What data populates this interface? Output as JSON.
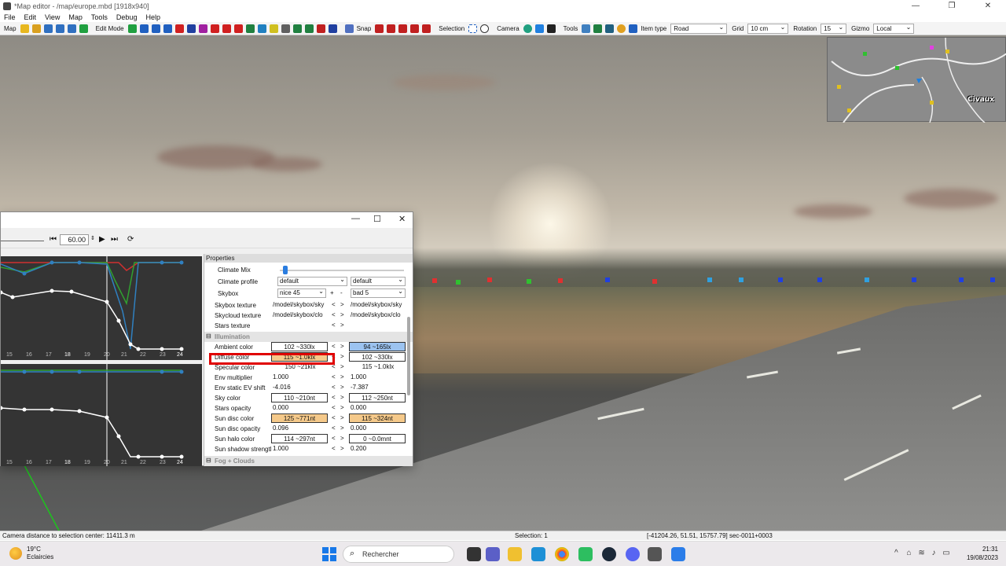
{
  "window": {
    "title": "*Map editor - /map/europe.mbd [1918x940]",
    "minimize": "—",
    "maximize": "❐",
    "close": "✕"
  },
  "menu": [
    "File",
    "Edit",
    "View",
    "Map",
    "Tools",
    "Debug",
    "Help"
  ],
  "toolbar": {
    "map_label": "Map",
    "edit_mode_label": "Edit Mode",
    "snap_label": "Snap",
    "selection_label": "Selection",
    "camera_label": "Camera",
    "tools_label": "Tools",
    "item_type_label": "Item type",
    "item_type_value": "Road",
    "grid_label": "Grid",
    "grid_value": "10 cm",
    "rotation_label": "Rotation",
    "rotation_value": "15",
    "gizmo_label": "Gizmo",
    "gizmo_value": "Local"
  },
  "minimap": {
    "label": "Civaux"
  },
  "panel": {
    "minimize": "—",
    "maximize": "☐",
    "close": "✕",
    "time_value": "60.00",
    "graph_ticks_top": [
      "15",
      "16",
      "17",
      "18",
      "19",
      "20",
      "21",
      "22",
      "23",
      "24"
    ],
    "graph_ticks_bottom": [
      "15",
      "16",
      "17",
      "18",
      "19",
      "20",
      "21",
      "22",
      "23",
      "24"
    ],
    "properties_header": "Properties",
    "climate_mix_label": "Climate Mix",
    "climate_profile_label": "Climate profile",
    "climate_profile_a": "default",
    "climate_profile_b": "default",
    "skybox_label": "Skybox",
    "skybox_a": "nice 45",
    "skybox_b": "bad 5",
    "skybox_plus": "+",
    "skybox_minus": "-",
    "rows": [
      {
        "label": "Skybox texture",
        "a": "/model/skybox/sky",
        "b": "/model/skybox/sky",
        "boxed": false
      },
      {
        "label": "Skycloud texture",
        "a": "/model/skybox/clo",
        "b": "/model/skybox/clo",
        "boxed": false
      },
      {
        "label": "Stars texture",
        "a": "",
        "b": "",
        "boxed": false
      }
    ],
    "illumination_label": "Illumination",
    "illum_rows": [
      {
        "label": "Ambient color",
        "a": "102 ~330lx",
        "b": "94 ~165lx"
      },
      {
        "label": "Diffuse color",
        "a": "115 ~1.0klx",
        "b": "102 ~330lx"
      },
      {
        "label": "Specular color",
        "a": "150 ~21klx",
        "b": "115 ~1.0klx"
      },
      {
        "label": "Env multiplier",
        "a": "1.000",
        "b": "1.000"
      },
      {
        "label": "Env static EV shift",
        "a": "-4.016",
        "b": "-7.387"
      },
      {
        "label": "Sky color",
        "a": "110 ~210nt",
        "b": "112 ~250nt"
      },
      {
        "label": "Stars opacity",
        "a": "0.000",
        "b": "0.000"
      },
      {
        "label": "Sun disc color",
        "a": "125 ~771nt",
        "b": "115 ~324nt"
      },
      {
        "label": "Sun disc opacity",
        "a": "0.096",
        "b": "0.000"
      },
      {
        "label": "Sun halo color",
        "a": "114 ~297nt",
        "b": "0 ~0.0mnt"
      },
      {
        "label": "Sun shadow strength",
        "a": "1.000",
        "b": "0.200"
      }
    ],
    "fog_label": "Fog + Clouds",
    "arrow_left": "<",
    "arrow_right": ">"
  },
  "status": {
    "camera_distance": "Camera distance to selection center: 11411.3 m",
    "selection": "Selection: 1",
    "coords": "[-41204.26, 51.51, 15757.79] sec-0011+0003"
  },
  "taskbar": {
    "temperature": "19°C",
    "weather": "Eclaircies",
    "search_placeholder": "Rechercher",
    "time": "21:31",
    "date": "19/08/2023",
    "tray_chevron": "^"
  },
  "colors": {
    "ambient_b_bg": "#9cc3f0",
    "diffuse_a_bg": "#f5c98a",
    "sun_disc_bg": "#f5c98a",
    "highlight": "#e00000"
  }
}
